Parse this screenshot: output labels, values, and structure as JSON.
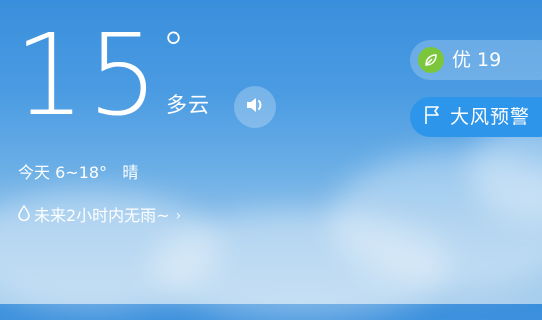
{
  "weather": {
    "temperature": "15",
    "unit": "°",
    "condition": "多云"
  },
  "today": {
    "label": "今天",
    "range": "6~18°",
    "condition": "晴"
  },
  "rain_forecast": "未来2小时内无雨~",
  "air_quality": {
    "label": "优 19",
    "color": "#7cc63c"
  },
  "alert": {
    "label": "大风预警"
  },
  "icons": [
    "speaker-icon",
    "water-drop-icon",
    "chevron-right-icon",
    "leaf-icon",
    "flag-icon"
  ],
  "colors": {
    "sky_top": "#3a8fdc",
    "sky_bottom": "#a9cfee",
    "alert_bg": "#2d95ea"
  }
}
